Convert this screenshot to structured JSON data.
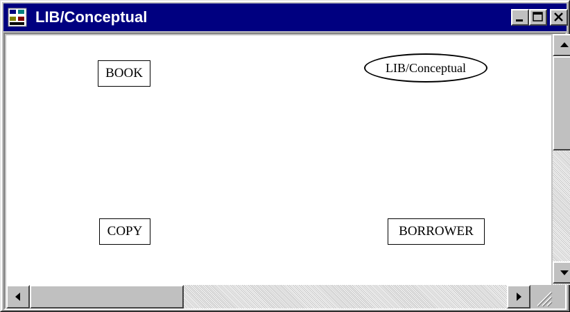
{
  "window": {
    "title": "LIB/Conceptual",
    "icon": "diagram-app-icon",
    "controls": {
      "minimize": "minimize-icon",
      "maximize": "maximize-icon",
      "close": "close-icon"
    }
  },
  "diagram": {
    "nodes": [
      {
        "id": "book",
        "label": "BOOK",
        "shape": "rectangle"
      },
      {
        "id": "title",
        "label": "LIB/Conceptual",
        "shape": "ellipse"
      },
      {
        "id": "copy",
        "label": "COPY",
        "shape": "rectangle"
      },
      {
        "id": "borrower",
        "label": "BORROWER",
        "shape": "rectangle"
      }
    ]
  },
  "scrollbars": {
    "vertical": {
      "up_icon": "arrow-up-icon",
      "down_icon": "arrow-down-icon"
    },
    "horizontal": {
      "left_icon": "arrow-left-icon",
      "right_icon": "arrow-right-icon"
    }
  },
  "colors": {
    "titlebar": "#000080",
    "face": "#c0c0c0",
    "canvas": "#ffffff"
  }
}
